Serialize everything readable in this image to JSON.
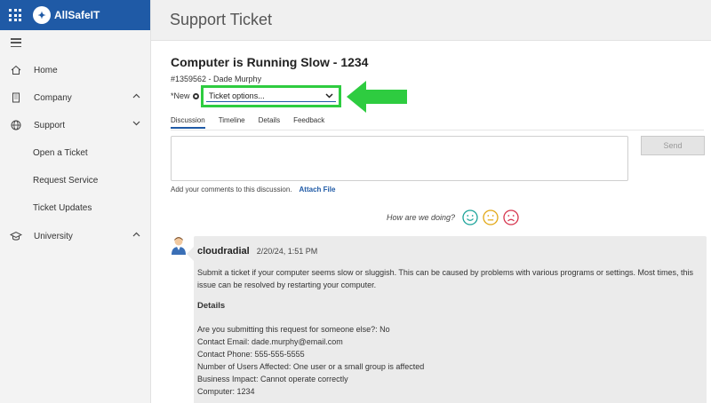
{
  "app": {
    "brand_name": "AllSafeIT",
    "logo_glyph": "✦",
    "brand_color": "#1f5aa6"
  },
  "sidebar": {
    "items": [
      {
        "label": "Home",
        "icon": "home-icon"
      },
      {
        "label": "Company",
        "icon": "building-icon"
      },
      {
        "label": "Support",
        "icon": "globe-icon"
      },
      {
        "label": "Open a Ticket"
      },
      {
        "label": "Request Service"
      },
      {
        "label": "Ticket Updates"
      },
      {
        "label": "University",
        "icon": "graduation-cap-icon"
      }
    ]
  },
  "header": {
    "title": "Support Ticket"
  },
  "ticket": {
    "title": "Computer is Running Slow - 1234",
    "meta": "#1359562 - Dade Murphy",
    "status": "*New",
    "options_placeholder": "Ticket options...",
    "highlight_color": "#2ecc40"
  },
  "tabs": [
    "Discussion",
    "Timeline",
    "Details",
    "Feedback"
  ],
  "discussion": {
    "send_label": "Send",
    "hint": "Add your comments to this discussion.",
    "attach_label": "Attach File",
    "feedback_prompt": "How are we doing?"
  },
  "message": {
    "author": "cloudradial",
    "date": "2/20/24, 1:51 PM",
    "body": "Submit a ticket if your computer seems slow or sluggish. This can be caused by problems with various programs or settings. Most times, this issue can be resolved by restarting your computer.",
    "details_title": "Details",
    "details": [
      "Are you submitting this request for someone else?: No",
      "Contact Email: dade.murphy@email.com",
      "Contact Phone: 555-555-5555",
      "Number of Users Affected: One user or a small group is affected",
      "Business Impact: Cannot operate correctly",
      "Computer: 1234"
    ]
  }
}
